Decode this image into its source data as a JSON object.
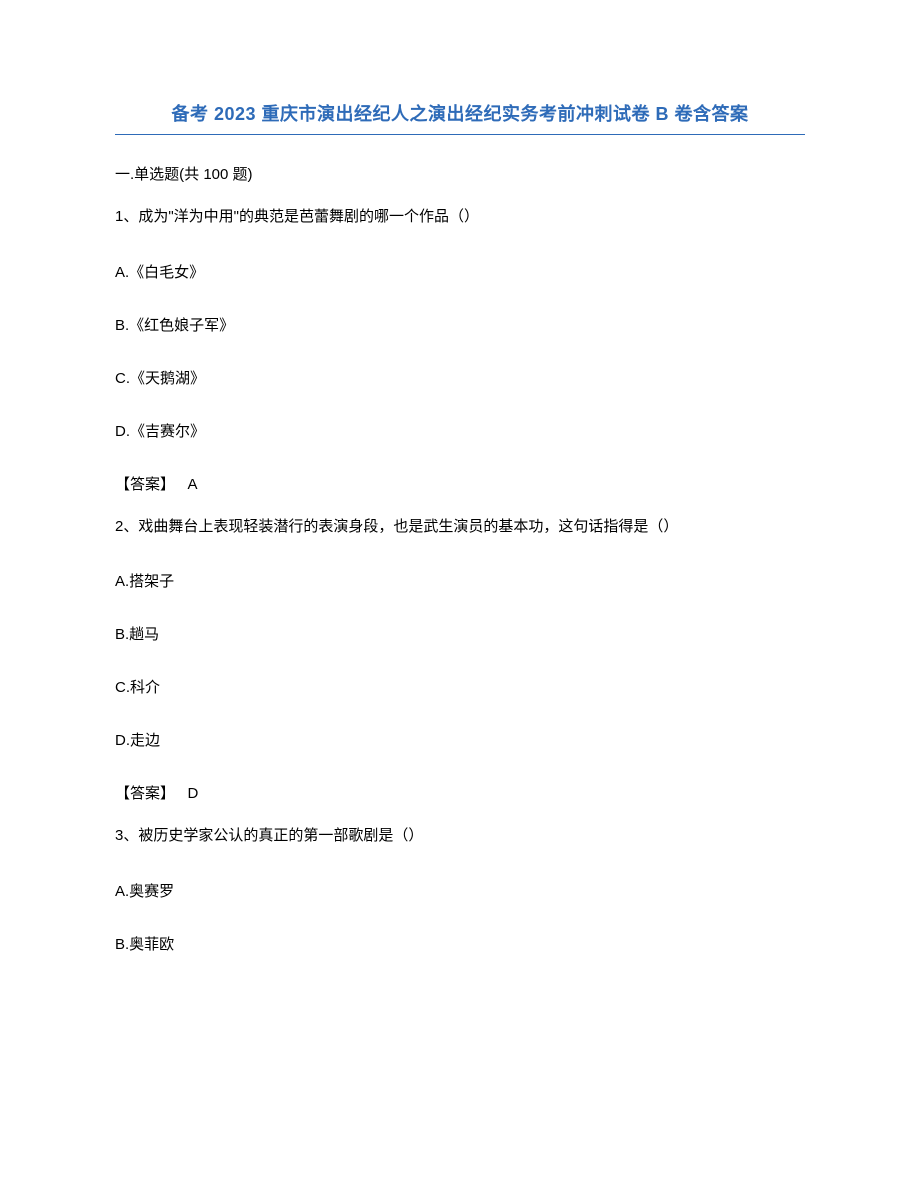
{
  "title": "备考 2023 重庆市演出经纪人之演出经纪实务考前冲刺试卷 B 卷含答案",
  "section_header": "一.单选题(共 100 题)",
  "questions": [
    {
      "number": "1、",
      "text": "成为\"洋为中用\"的典范是芭蕾舞剧的哪一个作品（）",
      "options": {
        "A": "A.《白毛女》",
        "B": "B.《红色娘子军》",
        "C": "C.《天鹅湖》",
        "D": "D.《吉赛尔》"
      },
      "answer_label": "【答案】",
      "answer_value": "A"
    },
    {
      "number": "2、",
      "text": "戏曲舞台上表现轻装潜行的表演身段，也是武生演员的基本功，这句话指得是（）",
      "options": {
        "A": "A.搭架子",
        "B": "B.趟马",
        "C": "C.科介",
        "D": "D.走边"
      },
      "answer_label": "【答案】",
      "answer_value": "D"
    },
    {
      "number": "3、",
      "text": "被历史学家公认的真正的第一部歌剧是（）",
      "options": {
        "A": "A.奥赛罗",
        "B": "B.奥菲欧"
      }
    }
  ]
}
